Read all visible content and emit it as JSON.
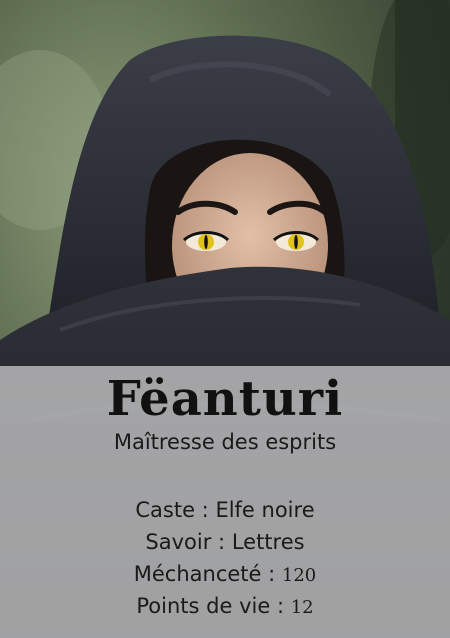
{
  "card": {
    "name": "Fëanturi",
    "title": "Maîtresse des esprits",
    "stats": [
      {
        "label": "Caste",
        "value": "Elfe noire"
      },
      {
        "label": "Savoir",
        "value": "Lettres"
      },
      {
        "label": "Méchanceté",
        "value": "120"
      },
      {
        "label": "Points de vie",
        "value": "12"
      }
    ],
    "separator": " : "
  },
  "colors": {
    "panel": "#c6c6c6",
    "cloak": "#2a2c33",
    "eyes": "#e0c21a",
    "background_foliage": "#5a6b4a"
  }
}
